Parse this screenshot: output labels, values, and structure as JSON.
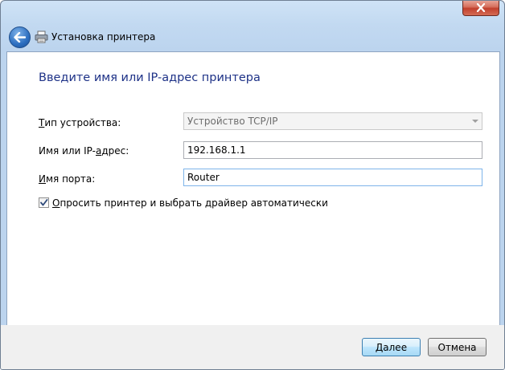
{
  "window": {
    "title": "Установка принтера"
  },
  "content": {
    "heading": "Введите имя или IP-адрес принтера"
  },
  "form": {
    "device_type": {
      "label_pre": "",
      "label_u": "Т",
      "label_post": "ип устройства:",
      "value": "Устройство TCP/IP"
    },
    "host": {
      "label_pre": "Имя или IP-",
      "label_u": "а",
      "label_post": "дрес:",
      "value": "192.168.1.1"
    },
    "port": {
      "label_pre": "",
      "label_u": "И",
      "label_post": "мя порта:",
      "value": "Router"
    },
    "query_printer": {
      "label_pre": "",
      "label_u": "О",
      "label_post": "просить принтер и выбрать драйвер автоматически",
      "checked": true
    }
  },
  "buttons": {
    "next": "Далее",
    "cancel": "Отмена"
  }
}
